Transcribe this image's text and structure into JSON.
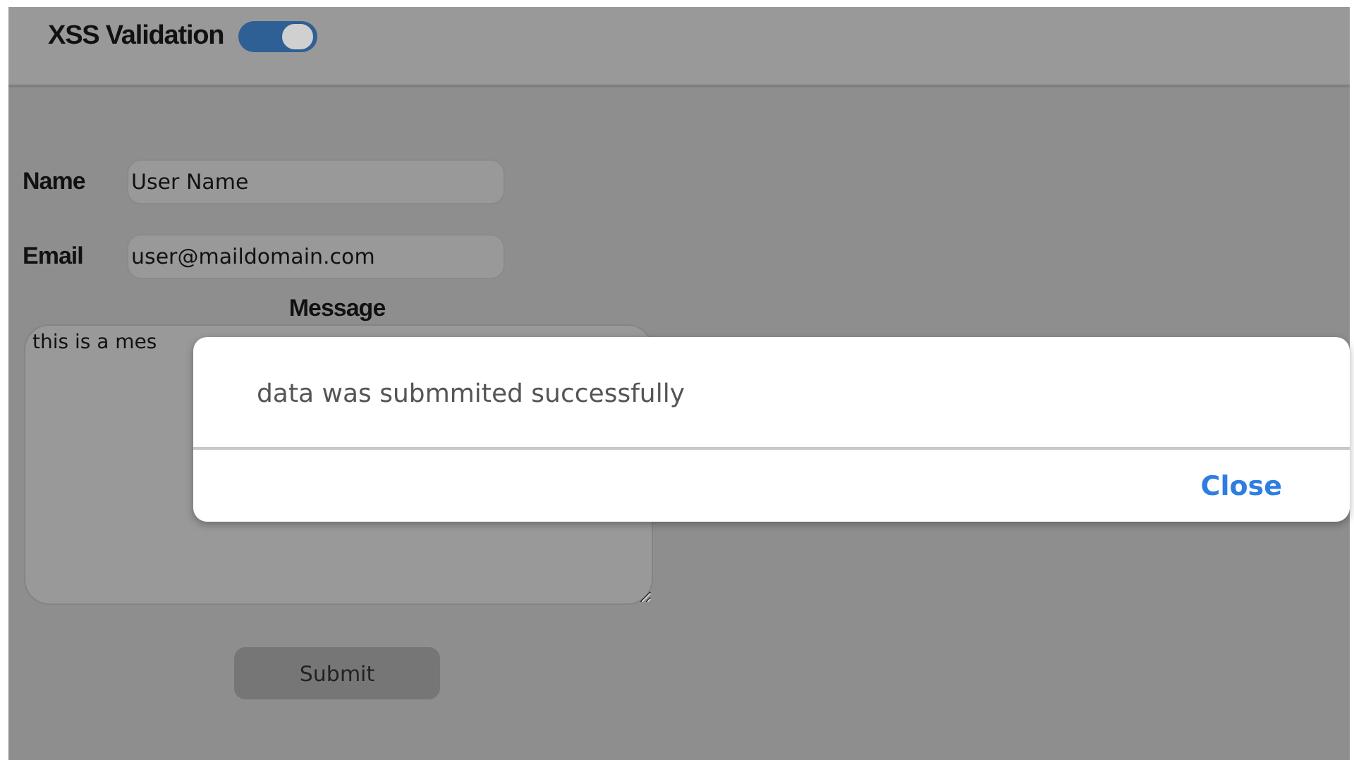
{
  "header": {
    "title": "XSS Validation",
    "toggle": {
      "on": true
    }
  },
  "form": {
    "fields": [
      {
        "label": "Name",
        "value": "User Name"
      },
      {
        "label": "Email",
        "value": "user@maildomain.com"
      }
    ],
    "message": {
      "label": "Message",
      "value": "this is a mes"
    },
    "submit": "Submit"
  },
  "dialog": {
    "message": "data was submmited successfully",
    "button": "Close"
  }
}
